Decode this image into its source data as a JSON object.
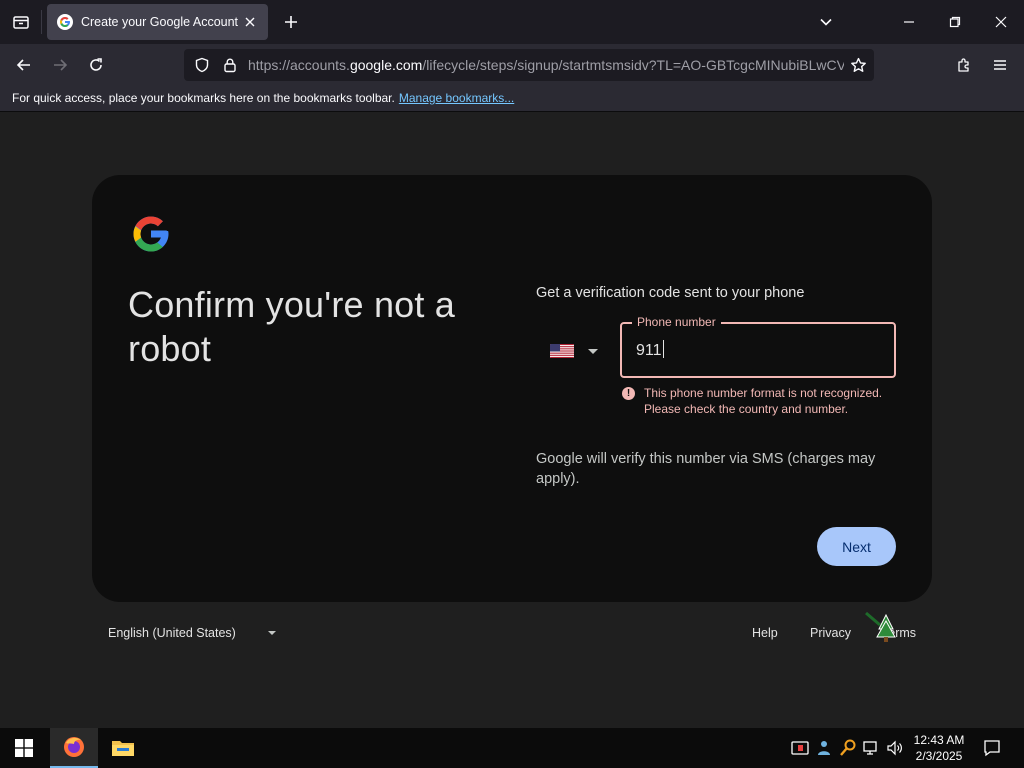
{
  "browser": {
    "tab_title": "Create your Google Account",
    "url_prefix": "https://accounts.",
    "url_domain": "google.com",
    "url_path": "/lifecycle/steps/signup/startmtsmsidv?TL=AO-GBTcgcMINubiBLwCVS",
    "bookmarks_message": "For quick access, place your bookmarks here on the bookmarks toolbar.",
    "bookmarks_link": "Manage bookmarks..."
  },
  "page": {
    "heading": "Confirm you're not a robot",
    "subtitle": "Get a verification code sent to your phone",
    "country_flag": "us-flag-icon",
    "phone_label": "Phone number",
    "phone_value": "911",
    "error_text": "This phone number format is not recognized. Please check the country and number.",
    "sms_note": "Google will verify this number via SMS (charges may apply).",
    "next_label": "Next"
  },
  "footer": {
    "language": "English (United States)",
    "help": "Help",
    "privacy": "Privacy",
    "terms": "Terms"
  },
  "taskbar": {
    "time": "12:43 AM",
    "date": "2/3/2025"
  },
  "colors": {
    "accent_button": "#a8c7fa",
    "error": "#f2b8b5",
    "card_bg": "#0e0e0e"
  }
}
